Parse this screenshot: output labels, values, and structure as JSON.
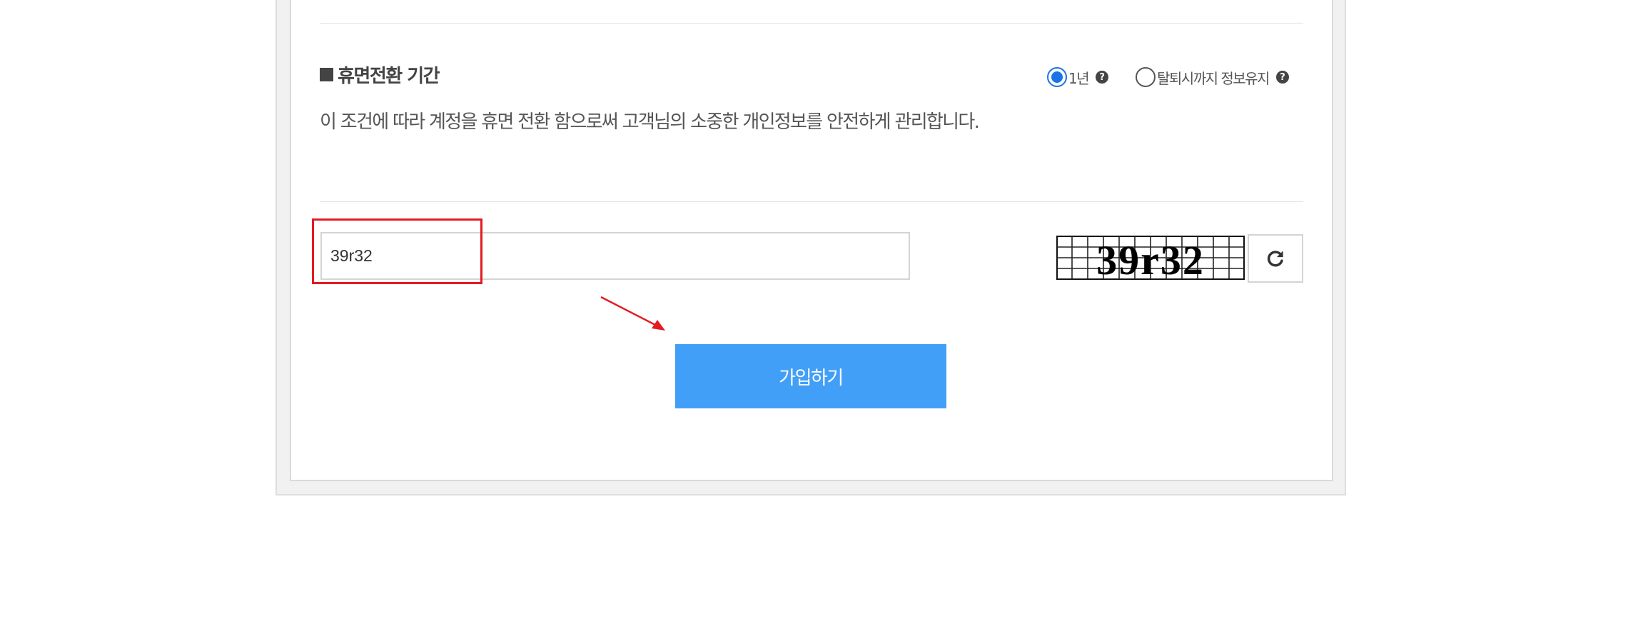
{
  "dormancy": {
    "title": "휴면전환 기간",
    "description": "이 조건에 따라 계정을 휴면 전환 함으로써 고객님의 소중한 개인정보를 안전하게 관리합니다.",
    "options": [
      {
        "label": "1년",
        "selected": true
      },
      {
        "label": "탈퇴시까지 정보유지",
        "selected": false
      }
    ]
  },
  "captcha": {
    "input_value": "39r32",
    "image_text": "39r32"
  },
  "signup": {
    "button_label": "가입하기"
  },
  "colors": {
    "highlight": "#e31b23",
    "button": "#429ff7",
    "radio_selected": "#1a73e8"
  },
  "icons": {
    "help": "question-circle-icon",
    "refresh": "refresh-icon"
  }
}
